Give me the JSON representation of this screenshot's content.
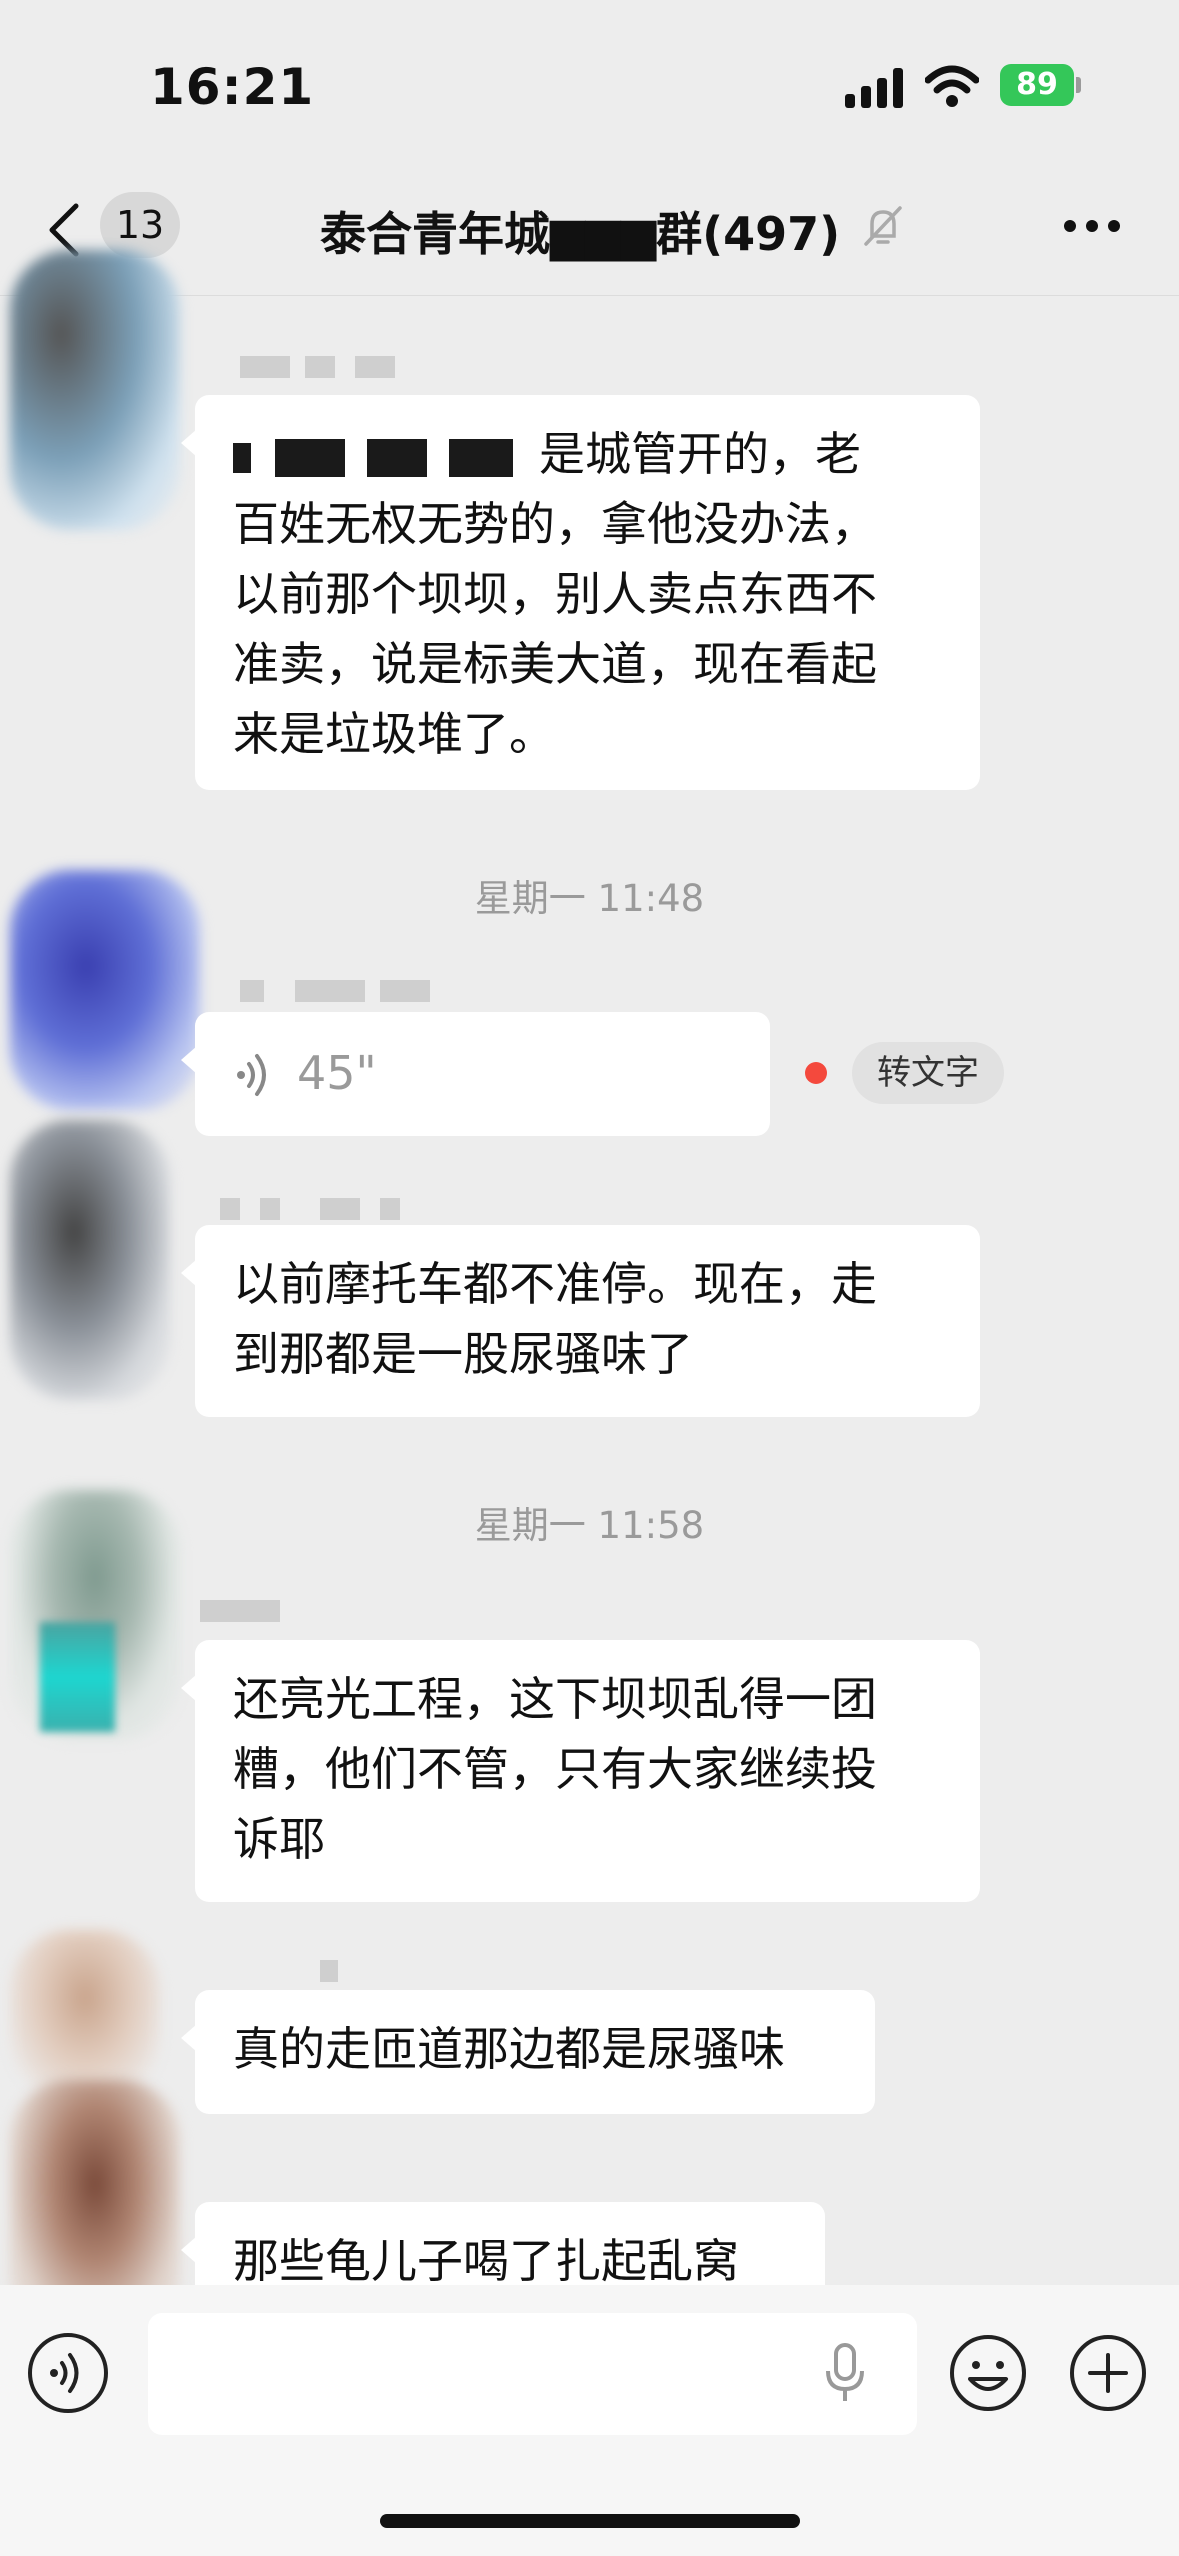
{
  "status_bar": {
    "time": "16:21",
    "battery": "89"
  },
  "nav": {
    "unread_count": "13",
    "title": "泰合青年城▆▆▆群(497)"
  },
  "messages": [
    {
      "lines": [
        "是城管开的，老",
        "百姓无权无势的，拿他没办法，",
        "以前那个坝坝，别人卖点东西不",
        "准卖，说是标美大道，现在看起",
        "来是垃圾堆了。"
      ]
    },
    {
      "timestamp": "星期一 11:48",
      "voice_duration": "45\"",
      "transcribe_label": "转文字"
    },
    {
      "lines": [
        "以前摩托车都不准停。现在，走",
        "到那都是一股尿骚味了"
      ]
    },
    {
      "timestamp": "星期一 11:58",
      "lines": [
        "还亮光工程，这下坝坝乱得一团",
        "糟，他们不管，只有大家继续投",
        "诉耶"
      ]
    },
    {
      "lines": [
        "真的走匝道那边都是尿骚味"
      ]
    },
    {
      "lines": [
        "那些龟儿子喝了扎起乱窝"
      ]
    }
  ],
  "icons": [
    "back-icon",
    "mute-icon",
    "more-icon",
    "voice-wave-icon",
    "mic-icon",
    "emoji-icon",
    "plus-icon"
  ]
}
